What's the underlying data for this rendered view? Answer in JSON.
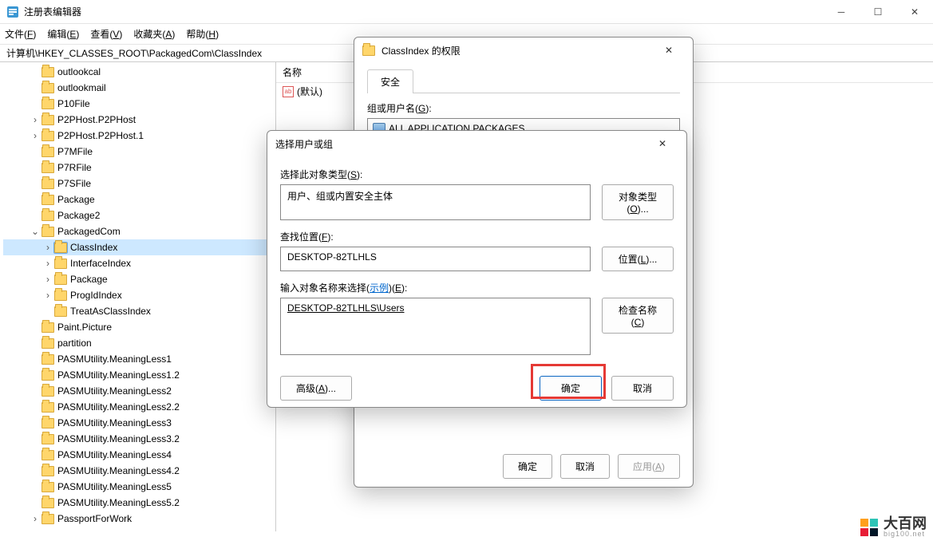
{
  "window": {
    "title": "注册表编辑器",
    "menu": [
      "文件(F)",
      "编辑(E)",
      "查看(V)",
      "收藏夹(A)",
      "帮助(H)"
    ],
    "address": "计算机\\HKEY_CLASSES_ROOT\\PackagedCom\\ClassIndex"
  },
  "tree": [
    {
      "indent": 2,
      "twisty": "",
      "label": "outlookcal"
    },
    {
      "indent": 2,
      "twisty": "",
      "label": "outlookmail"
    },
    {
      "indent": 2,
      "twisty": "",
      "label": "P10File"
    },
    {
      "indent": 2,
      "twisty": ">",
      "label": "P2PHost.P2PHost"
    },
    {
      "indent": 2,
      "twisty": ">",
      "label": "P2PHost.P2PHost.1"
    },
    {
      "indent": 2,
      "twisty": "",
      "label": "P7MFile"
    },
    {
      "indent": 2,
      "twisty": "",
      "label": "P7RFile"
    },
    {
      "indent": 2,
      "twisty": "",
      "label": "P7SFile"
    },
    {
      "indent": 2,
      "twisty": "",
      "label": "Package"
    },
    {
      "indent": 2,
      "twisty": "",
      "label": "Package2"
    },
    {
      "indent": 2,
      "twisty": "v",
      "label": "PackagedCom"
    },
    {
      "indent": 3,
      "twisty": ">",
      "label": "ClassIndex",
      "selected": true
    },
    {
      "indent": 3,
      "twisty": ">",
      "label": "InterfaceIndex"
    },
    {
      "indent": 3,
      "twisty": ">",
      "label": "Package"
    },
    {
      "indent": 3,
      "twisty": ">",
      "label": "ProgIdIndex"
    },
    {
      "indent": 3,
      "twisty": "",
      "label": "TreatAsClassIndex"
    },
    {
      "indent": 2,
      "twisty": "",
      "label": "Paint.Picture"
    },
    {
      "indent": 2,
      "twisty": "",
      "label": "partition"
    },
    {
      "indent": 2,
      "twisty": "",
      "label": "PASMUtility.MeaningLess1"
    },
    {
      "indent": 2,
      "twisty": "",
      "label": "PASMUtility.MeaningLess1.2"
    },
    {
      "indent": 2,
      "twisty": "",
      "label": "PASMUtility.MeaningLess2"
    },
    {
      "indent": 2,
      "twisty": "",
      "label": "PASMUtility.MeaningLess2.2"
    },
    {
      "indent": 2,
      "twisty": "",
      "label": "PASMUtility.MeaningLess3"
    },
    {
      "indent": 2,
      "twisty": "",
      "label": "PASMUtility.MeaningLess3.2"
    },
    {
      "indent": 2,
      "twisty": "",
      "label": "PASMUtility.MeaningLess4"
    },
    {
      "indent": 2,
      "twisty": "",
      "label": "PASMUtility.MeaningLess4.2"
    },
    {
      "indent": 2,
      "twisty": "",
      "label": "PASMUtility.MeaningLess5"
    },
    {
      "indent": 2,
      "twisty": "",
      "label": "PASMUtility.MeaningLess5.2"
    },
    {
      "indent": 2,
      "twisty": ">",
      "label": "PassportForWork"
    }
  ],
  "list": {
    "header_name": "名称",
    "default_value": "(默认)"
  },
  "perm_dialog": {
    "title": "ClassIndex 的权限",
    "tab": "安全",
    "group_label_pre": "组或用户名(",
    "group_label_u": "G",
    "group_label_post": "):",
    "group_item": "ALL APPLICATION PACKAGES",
    "ok": "确定",
    "cancel": "取消",
    "apply_pre": "应用(",
    "apply_u": "A",
    "apply_post": ")"
  },
  "select_dialog": {
    "title": "选择用户或组",
    "obj_type_label_pre": "选择此对象类型(",
    "obj_type_label_u": "S",
    "obj_type_label_post": "):",
    "obj_type_value": "用户、组或内置安全主体",
    "obj_type_btn_pre": "对象类型(",
    "obj_type_btn_u": "O",
    "obj_type_btn_post": ")...",
    "loc_label_pre": "查找位置(",
    "loc_label_u": "F",
    "loc_label_post": "):",
    "loc_value": "DESKTOP-82TLHLS",
    "loc_btn_pre": "位置(",
    "loc_btn_u": "L",
    "loc_btn_post": ")...",
    "name_label_pre": "输入对象名称来选择(",
    "name_label_link": "示例",
    "name_label_post_pre": ")(",
    "name_label_u": "E",
    "name_label_post": "):",
    "name_value": "DESKTOP-82TLHLS\\Users",
    "check_btn_pre": "检查名称(",
    "check_btn_u": "C",
    "check_btn_post": ")",
    "advanced_pre": "高级(",
    "advanced_u": "A",
    "advanced_post": ")...",
    "ok": "确定",
    "cancel": "取消"
  },
  "watermark": {
    "big": "大百网",
    "small": "big100.net"
  }
}
